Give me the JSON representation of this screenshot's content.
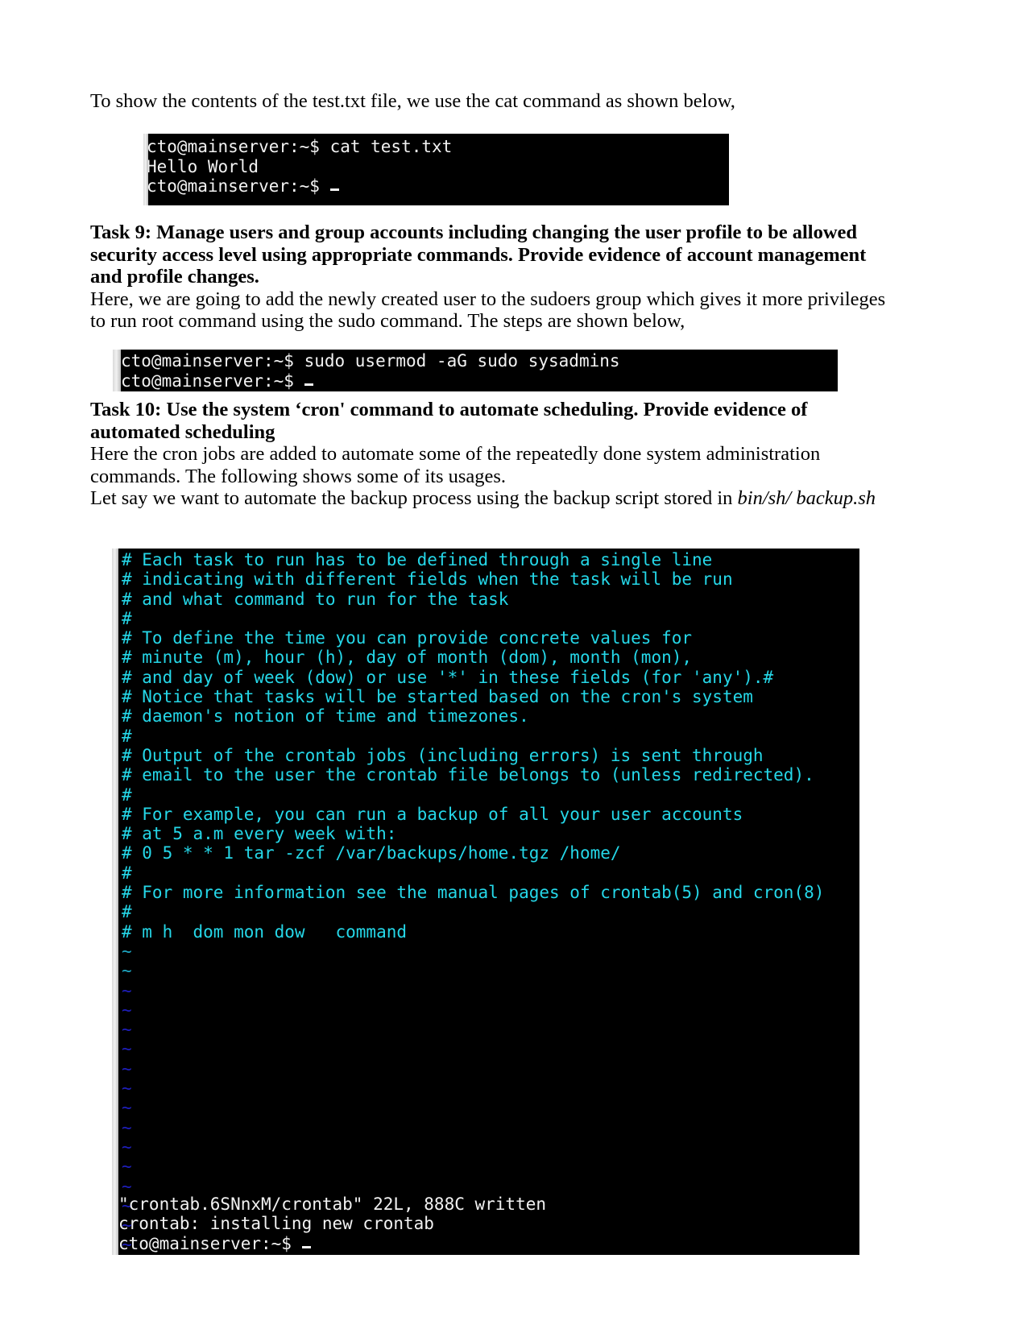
{
  "document": {
    "intro_paragraph": "To show the contents of the test.txt file, we use the cat command as shown below,",
    "task9": {
      "heading": "Task 9: Manage users and group accounts including changing the user profile to be allowed security access level using appropriate commands. Provide evidence of account management and profile changes.",
      "paragraph": "Here, we are going to add the newly created user to the sudoers group which gives it more privileges to run root command using the sudo command. The steps are shown below,"
    },
    "task10": {
      "heading": "Task 10: Use the system ‘cron' command to automate scheduling. Provide evidence of automated scheduling",
      "paragraph": "Here the cron jobs are added to automate some of the repeatedly done system administration commands. The following shows some of its usages.",
      "paragraph2_prefix": "Let say we want to automate the backup process using the backup script stored in ",
      "paragraph2_italic": "bin/sh/ backup.sh"
    }
  },
  "terminal_cat": {
    "lines": [
      "cto@mainserver:~$ cat test.txt",
      "Hello World",
      "cto@mainserver:~$ "
    ]
  },
  "terminal_usermod": {
    "lines": [
      "cto@mainserver:~$ sudo usermod -aG sudo sysadmins",
      "cto@mainserver:~$ "
    ]
  },
  "terminal_crontab": {
    "comment_lines": [
      "# Each task to run has to be defined through a single line",
      "# indicating with different fields when the task will be run",
      "# and what command to run for the task",
      "#",
      "# To define the time you can provide concrete values for",
      "# minute (m), hour (h), day of month (dom), month (mon),",
      "# and day of week (dow) or use '*' in these fields (for 'any').#",
      "# Notice that tasks will be started based on the cron's system",
      "# daemon's notion of time and timezones.",
      "#",
      "# Output of the crontab jobs (including errors) is sent through",
      "# email to the user the crontab file belongs to (unless redirected).",
      "#",
      "# For example, you can run a backup of all your user accounts",
      "# at 5 a.m every week with:",
      "# 0 5 * * 1 tar -zcf /var/backups/home.tgz /home/",
      "#",
      "# For more information see the manual pages of crontab(5) and cron(8)",
      "#",
      "# m h  dom mon dow   command"
    ],
    "tilde_marker": "~",
    "tilde_count": 16,
    "status_lines": [
      "\"crontab.6SNnxM/crontab\" 22L, 888C written",
      "crontab: installing new crontab",
      "cto@mainserver:~$ "
    ]
  },
  "colors": {
    "terminal_background": "#000000",
    "terminal_text": "#ffffff",
    "crontab_comment_text": "#25d7e8",
    "tilde_text": "#1f1fbe",
    "page_background": "#ffffff"
  }
}
